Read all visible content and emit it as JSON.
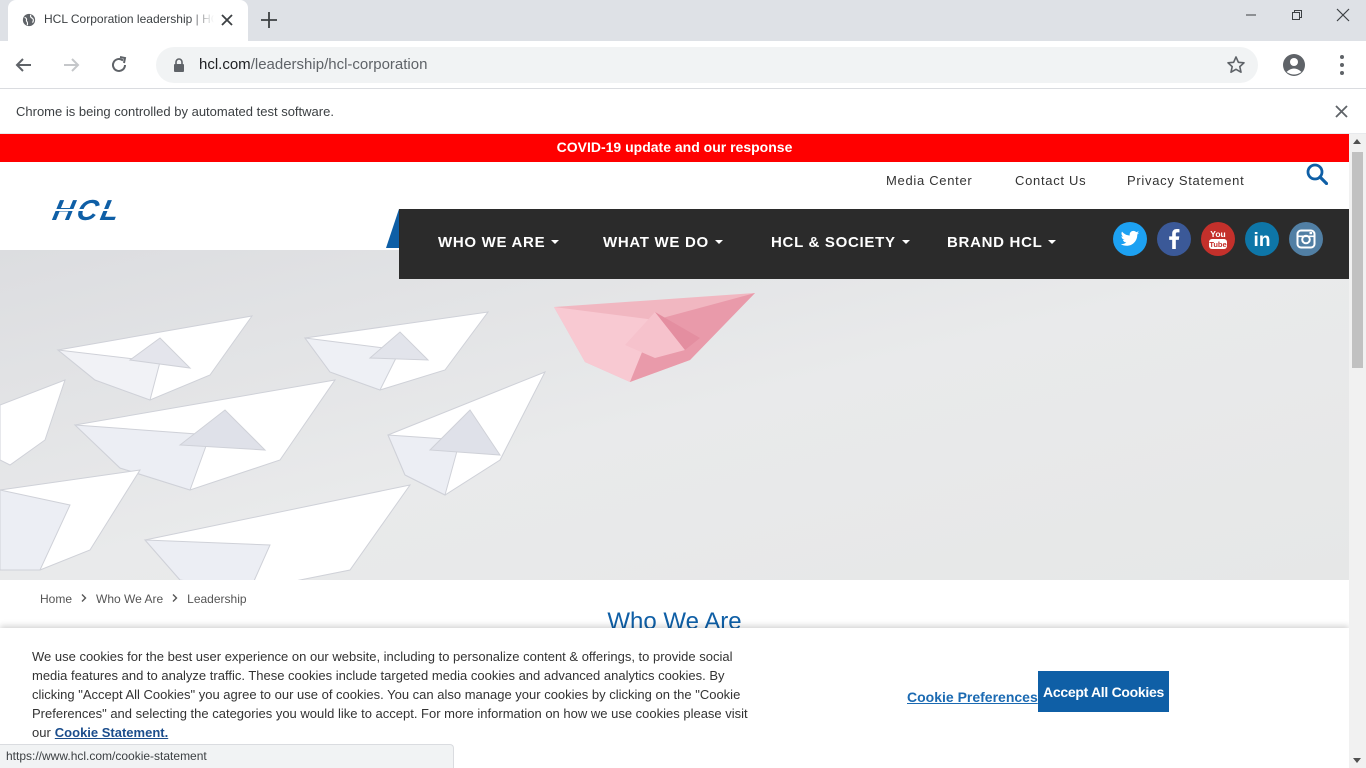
{
  "browser": {
    "tab_title": "HCL Corporation leadership | HCL Corporation",
    "url_host": "hcl.com",
    "url_path": "/leadership/hcl-corporation",
    "infobar_text": "Chrome is being controlled by automated test software.",
    "status_url": "https://www.hcl.com/cookie-statement"
  },
  "site": {
    "covid_banner": "COVID-19 update and our response",
    "utility_links": [
      "Media Center",
      "Contact Us",
      "Privacy Statement"
    ],
    "logo_text": "HCL",
    "nav": [
      "WHO WE ARE",
      "WHAT WE DO",
      "HCL & SOCIETY",
      "BRAND HCL"
    ],
    "social": [
      "twitter-icon",
      "facebook-icon",
      "youtube-icon",
      "linkedin-icon",
      "instagram-icon"
    ],
    "social_text": {
      "youtube_top": "You",
      "youtube_bottom": "Tube",
      "linkedin": "in"
    }
  },
  "breadcrumb": [
    "Home",
    "Who We Are",
    "Leadership"
  ],
  "section_title": "Who We Are",
  "cookie": {
    "text": "We use cookies for the best user experience on our website, including to personalize content & offerings, to provide social media features and to analyze traffic. These cookies include targeted media cookies and advanced analytics cookies. By clicking \"Accept All Cookies\" you agree to our use of cookies. You can also manage your cookies by clicking on the \"Cookie Preferences\" and selecting the categories you would like to accept. For more information on how we use cookies please visit our",
    "link": "Cookie Statement.",
    "preferences_label": "Cookie Preferences",
    "accept_label": "Accept All Cookies"
  },
  "colors": {
    "brand_blue": "#0f5fa6",
    "covid_red": "#ff0000",
    "nav_dark": "#2b2b2b"
  }
}
